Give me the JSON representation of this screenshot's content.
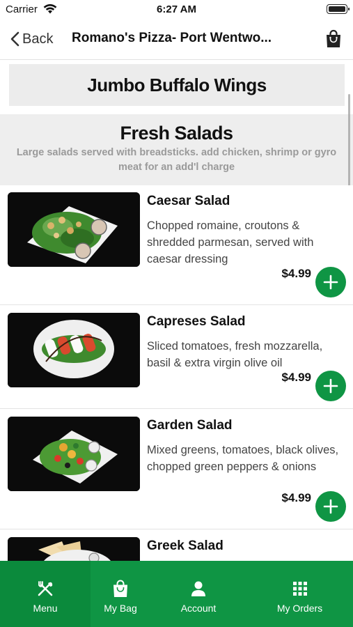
{
  "status_bar": {
    "carrier": "Carrier",
    "time": "6:27 AM"
  },
  "nav": {
    "back_label": "Back",
    "title": "Romano's Pizza- Port Wentwo..."
  },
  "sections": {
    "wings": {
      "title": "Jumbo Buffalo Wings"
    },
    "salads": {
      "title": "Fresh Salads",
      "subtitle": "Large salads served with breadsticks. add chicken, shrimp or gyro meat for an add'l charge"
    }
  },
  "menu_items": [
    {
      "name": "Caesar Salad",
      "description": "Chopped romaine, croutons & shredded parmesan, served with caesar dressing",
      "price": "$4.99"
    },
    {
      "name": "Capreses Salad",
      "description": "Sliced tomatoes, fresh mozzarella, basil & extra virgin olive oil",
      "price": "$4.99"
    },
    {
      "name": "Garden Salad",
      "description": "Mixed greens, tomatoes, black olives, chopped green peppers & onions",
      "price": "$4.99"
    },
    {
      "name": "Greek Salad",
      "description": "",
      "price": ""
    }
  ],
  "tabs": [
    {
      "label": "Menu",
      "icon": "fork-knife-icon",
      "active": true
    },
    {
      "label": "My Bag",
      "icon": "shopping-bag-icon",
      "active": false
    },
    {
      "label": "Account",
      "icon": "person-icon",
      "active": false
    },
    {
      "label": "My Orders",
      "icon": "grid-icon",
      "active": false
    }
  ],
  "colors": {
    "brand_green": "#0f9544",
    "active_tab": "#0b8a3c",
    "section_bg": "#eeeeee"
  }
}
